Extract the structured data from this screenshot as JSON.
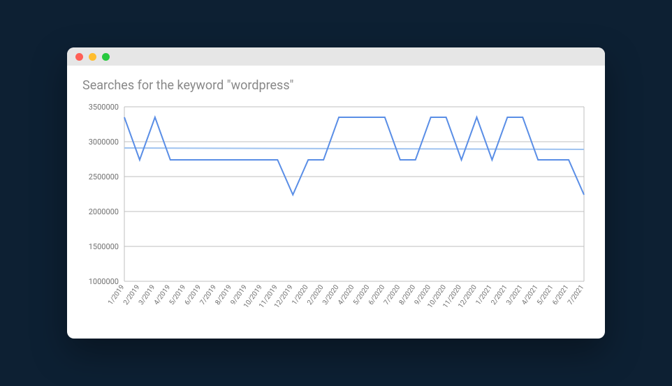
{
  "chart_data": {
    "type": "line",
    "title": "Searches for the keyword \"wordpress\"",
    "xlabel": "",
    "ylabel": "",
    "ylim": [
      1000000,
      3500000
    ],
    "yticks": [
      1000000,
      1500000,
      2000000,
      2500000,
      3000000,
      3500000
    ],
    "categories": [
      "1/2019",
      "2/2019",
      "3/2019",
      "4/2019",
      "5/2019",
      "6/2019",
      "7/2019",
      "8/2019",
      "9/2019",
      "10/2019",
      "11/2019",
      "12/2019",
      "1/2020",
      "2/2020",
      "3/2020",
      "4/2020",
      "5/2020",
      "6/2020",
      "7/2020",
      "8/2020",
      "9/2020",
      "10/2020",
      "11/2020",
      "12/2020",
      "1/2021",
      "2/2021",
      "3/2021",
      "4/2021",
      "5/2021",
      "6/2021",
      "7/2021"
    ],
    "values": [
      3350000,
      2740000,
      3350000,
      2740000,
      2740000,
      2740000,
      2740000,
      2740000,
      2740000,
      2740000,
      2740000,
      2240000,
      2740000,
      2740000,
      3350000,
      3350000,
      3350000,
      3350000,
      2740000,
      2740000,
      3350000,
      3350000,
      2740000,
      3350000,
      2740000,
      3350000,
      3350000,
      2740000,
      2740000,
      2740000,
      2240000
    ],
    "trend": {
      "start": 2910000,
      "end": 2890000
    }
  }
}
